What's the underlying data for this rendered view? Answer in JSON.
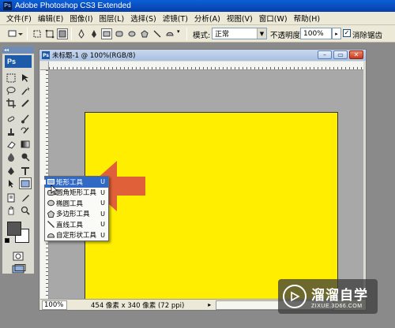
{
  "app": {
    "title": "Adobe Photoshop CS3 Extended",
    "logo": "Ps"
  },
  "menu": [
    "文件(F)",
    "编辑(E)",
    "图像(I)",
    "图层(L)",
    "选择(S)",
    "滤镜(T)",
    "分析(A)",
    "视图(V)",
    "窗口(W)",
    "帮助(H)"
  ],
  "options": {
    "mode_label": "模式:",
    "mode_value": "正常",
    "opacity_label": "不透明度:",
    "opacity_value": "100%",
    "antialias_label": "消除锯齿",
    "antialias_checked": true
  },
  "document": {
    "title": "未标题-1 @ 100%(RGB/8)",
    "canvas_color": "#ffee00",
    "zoom": "100%",
    "status": "454 像素 x 340 像素 (72 ppi)"
  },
  "flyout": {
    "items": [
      {
        "label": "矩形工具",
        "key": "U",
        "icon": "rectangle-icon",
        "active": true
      },
      {
        "label": "圆角矩形工具",
        "key": "U",
        "icon": "rounded-rectangle-icon",
        "active": false
      },
      {
        "label": "椭圆工具",
        "key": "U",
        "icon": "ellipse-icon",
        "active": false
      },
      {
        "label": "多边形工具",
        "key": "U",
        "icon": "polygon-icon",
        "active": false
      },
      {
        "label": "直线工具",
        "key": "U",
        "icon": "line-icon",
        "active": false
      },
      {
        "label": "自定形状工具",
        "key": "U",
        "icon": "custom-shape-icon",
        "active": false
      }
    ]
  },
  "watermark": {
    "name": "溜溜自学",
    "url": "ZIXUE.3D66.COM"
  },
  "colors": {
    "accent_arrow": "#e0603a",
    "titlebar": "#0a4fc8"
  }
}
